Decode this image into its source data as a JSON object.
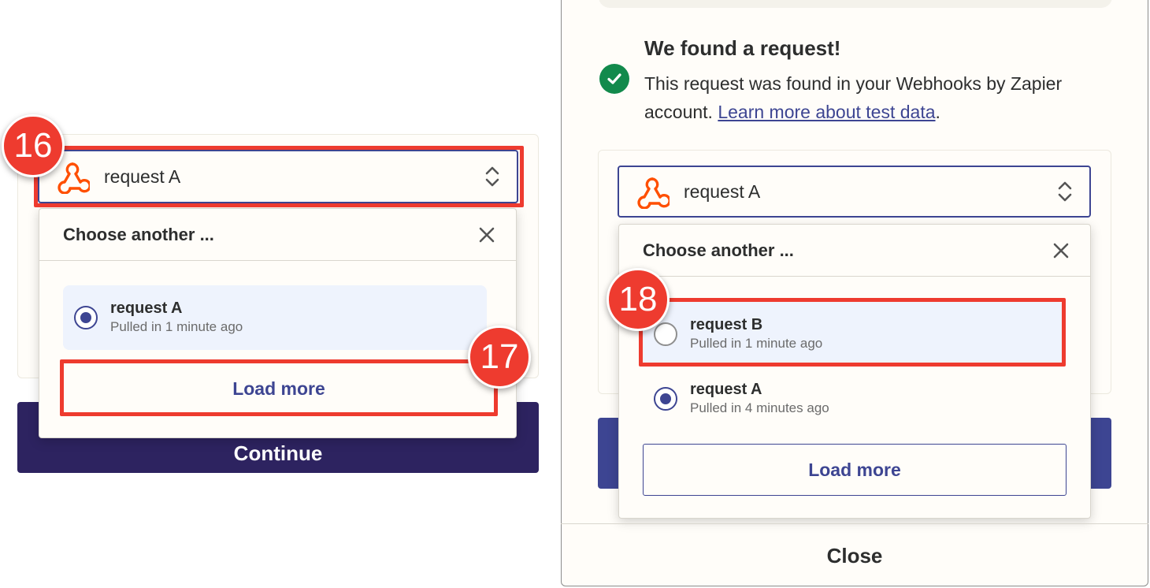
{
  "left": {
    "selected_value": "request A",
    "dropdown_title": "Choose another ...",
    "options": [
      {
        "name": "request A",
        "sub": "Pulled in 1 minute ago",
        "selected": true
      }
    ],
    "load_more": "Load more",
    "continue": "Continue"
  },
  "right": {
    "found_title": "We found a request!",
    "found_desc": "This request was found in your Webhooks by Zapier account. ",
    "learn_more": "Learn more about test data",
    "found_desc_end": ".",
    "selected_value": "request A",
    "dropdown_title": "Choose another ...",
    "options": [
      {
        "name": "request B",
        "sub": "Pulled in 1 minute ago",
        "selected": false
      },
      {
        "name": "request A",
        "sub": "Pulled in 4 minutes ago",
        "selected": true
      }
    ],
    "load_more": "Load more",
    "close": "Close"
  },
  "badges": {
    "b16": "16",
    "b17": "17",
    "b18": "18"
  },
  "colors": {
    "accent": "#3d4592",
    "highlight": "#ee3b2f",
    "success": "#128a4c",
    "webhook": "#ff4f00"
  },
  "icons": [
    "webhook-icon",
    "up-down-chevron-icon",
    "close-icon",
    "check-icon",
    "radio-icon"
  ]
}
